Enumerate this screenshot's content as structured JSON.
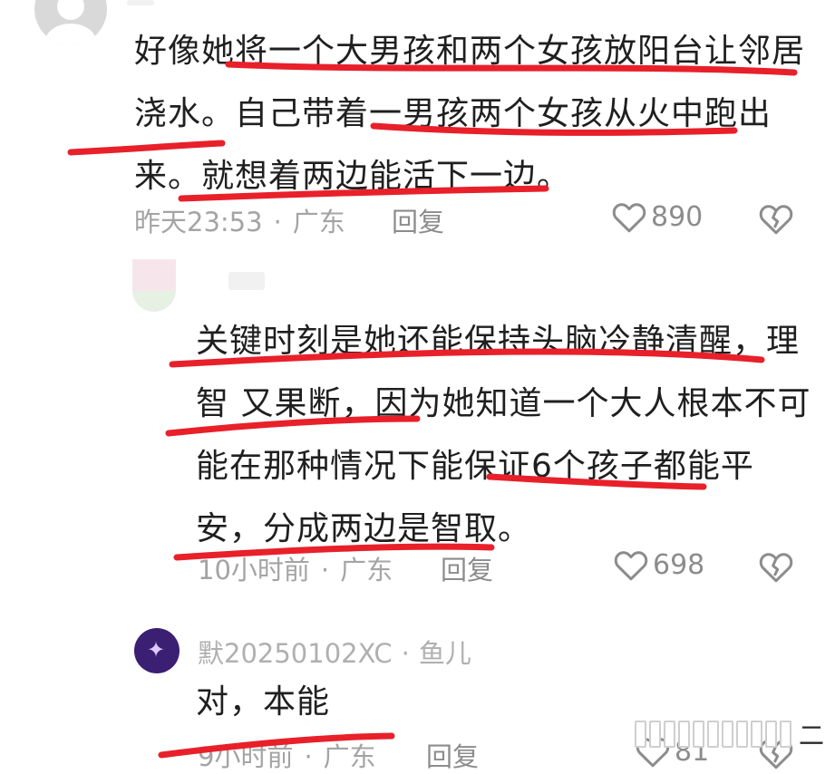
{
  "comments": [
    {
      "text": "好像她将一个大男孩和两个女孩放阳台让邻居浇水。自己带着一男孩两个女孩从火中跑出来。就想着两边能活下一边。",
      "time": "昨天23:53",
      "region": "广东",
      "reply_label": "回复",
      "likes": "890"
    },
    {
      "text": "关键时刻是她还能保持头脑冷静清醒，理智 又果断，因为她知道一个大人根本不可能在那种情况下能保证6个孩子都能平安，分成两边是智取。",
      "time": "10小时前",
      "region": "广东",
      "reply_label": "回复",
      "likes": "698"
    },
    {
      "user": "默20250102XC",
      "user_suffix": "鱼儿",
      "text": "对，本能",
      "time": "9小时前",
      "region": "广东",
      "reply_label": "回复",
      "likes": "81"
    }
  ],
  "meta_separator": "·",
  "watermark_text": "二",
  "colors": {
    "underline": "#e8202a",
    "meta": "#a4a4a4",
    "icon": "#8c8c8c"
  },
  "icons": [
    "avatar-icon",
    "heart-icon",
    "broken-heart-icon"
  ]
}
